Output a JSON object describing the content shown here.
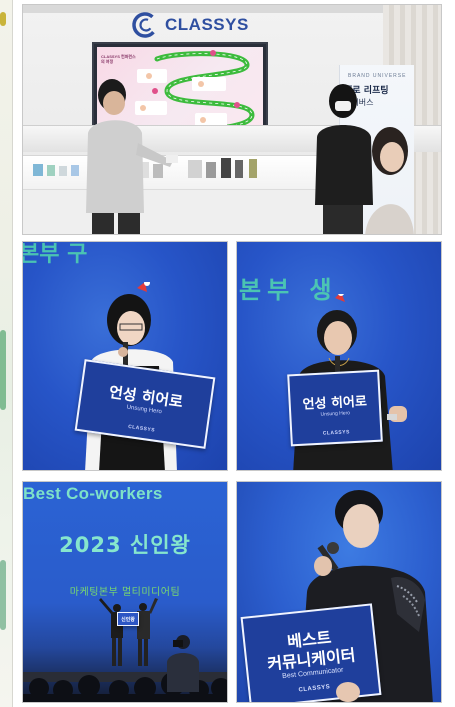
{
  "photo_showroom": {
    "logo_text": "CLASSYS",
    "screen_title": "CLASSYS 컨퍼런스의 여정",
    "screen_stops": [
      "04",
      "05",
      "06",
      "07",
      "08"
    ],
    "banner_small": "BRAND UNIVERSE",
    "banner_line1": "대로 리프팅",
    "banner_line2": "유니버스"
  },
  "photo_unsung_1": {
    "bg_text": "본부 구",
    "sign_ko": "언성 히어로",
    "sign_en": "Unsung Hero",
    "sign_brand": "CLASSYS"
  },
  "photo_unsung_2": {
    "bg_text": "본부 생",
    "sign_ko": "언성 히어로",
    "sign_en": "Unsung Hero",
    "sign_brand": "CLASSYS"
  },
  "photo_rookie": {
    "title": "Best Co-workers",
    "big": "2023 신인왕",
    "sub": "마케팅본부 멀티미디어팀",
    "sign_small": "신인왕"
  },
  "photo_communicator": {
    "sign_ko_line1": "베스트",
    "sign_ko_line2": "커뮤니케이터",
    "sign_en": "Best Communicator",
    "sign_brand": "CLASSYS"
  },
  "colors": {
    "stage_blue": "#2755c8",
    "screen_text_green": "#86e6cd",
    "sign_navy": "#1f3f9c",
    "brand_blue": "#2f4fa0"
  }
}
